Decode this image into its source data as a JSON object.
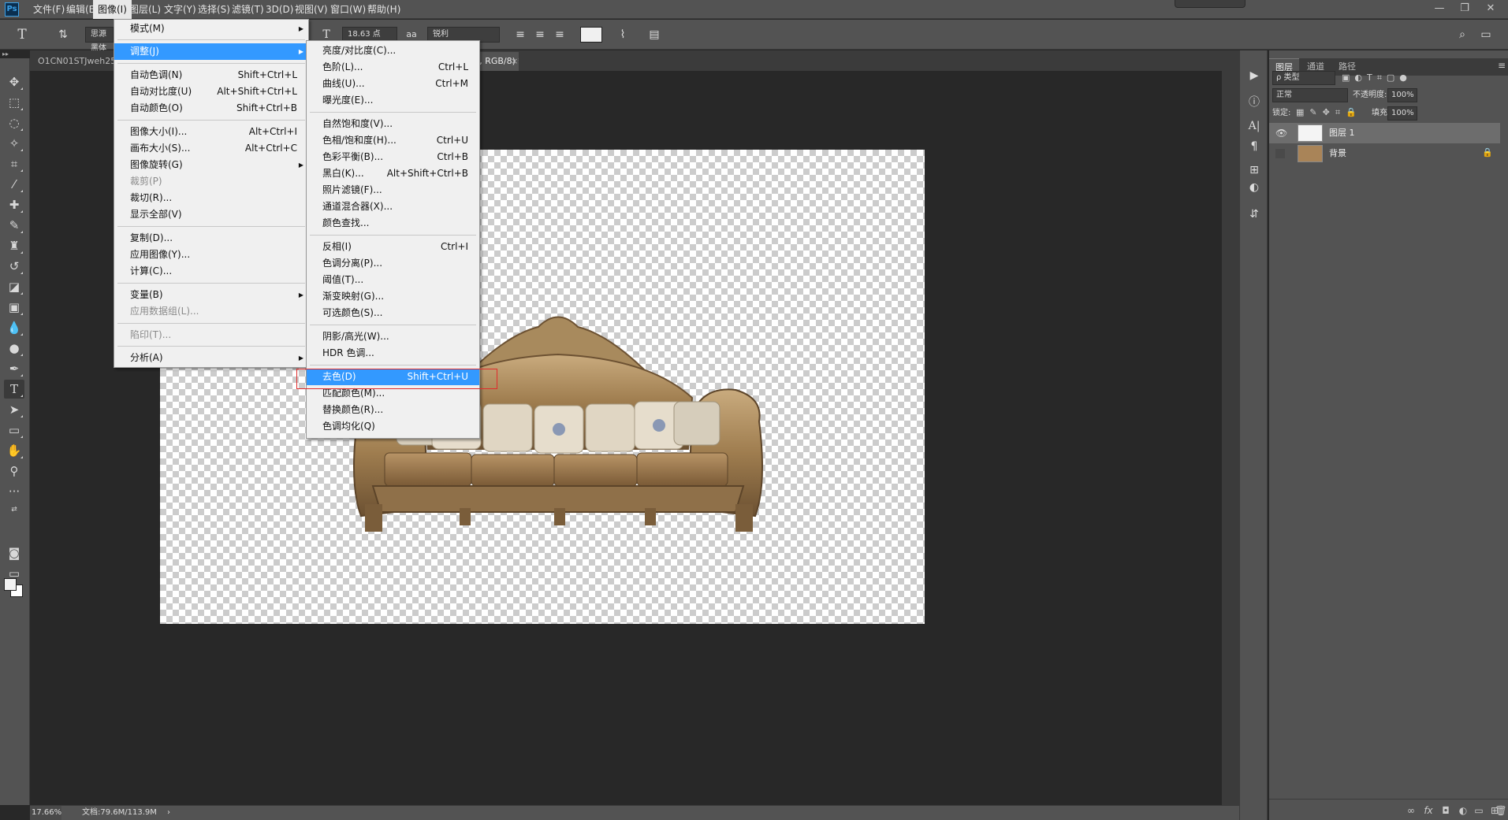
{
  "app": {
    "logo": "Ps"
  },
  "menubar": {
    "items": [
      "文件(F)",
      "编辑(E)",
      "图像(I)",
      "图层(L)",
      "文字(Y)",
      "选择(S)",
      "滤镜(T)",
      "3D(D)",
      "视图(V)",
      "窗口(W)",
      "帮助(H)"
    ],
    "active": "图像(I)"
  },
  "window_controls": {
    "minimize": "—",
    "restore": "❐",
    "close": "✕"
  },
  "options": {
    "font_family": "思源黑体",
    "font_size": "18.63 点",
    "antialias_icon": "aa",
    "antialias": "锐利"
  },
  "tabs": [
    {
      "label": "O1CN01STJweh25F",
      "active": false
    },
    {
      "label": "d @ 17.7% (图层 1, RGB/8) *",
      "active": true,
      "close": "×"
    }
  ],
  "status": {
    "zoom": "17.66%",
    "doc_size": "文档:79.6M/113.9M",
    "arrow": "›"
  },
  "image_menu": {
    "groups": [
      [
        {
          "label": "模式(M)",
          "submenu": true
        }
      ],
      [
        {
          "label": "调整(J)",
          "submenu": true,
          "highlighted": true
        }
      ],
      [
        {
          "label": "自动色调(N)",
          "shortcut": "Shift+Ctrl+L"
        },
        {
          "label": "自动对比度(U)",
          "shortcut": "Alt+Shift+Ctrl+L"
        },
        {
          "label": "自动颜色(O)",
          "shortcut": "Shift+Ctrl+B"
        }
      ],
      [
        {
          "label": "图像大小(I)...",
          "shortcut": "Alt+Ctrl+I"
        },
        {
          "label": "画布大小(S)...",
          "shortcut": "Alt+Ctrl+C"
        },
        {
          "label": "图像旋转(G)",
          "submenu": true
        },
        {
          "label": "裁剪(P)",
          "disabled": true
        },
        {
          "label": "裁切(R)..."
        },
        {
          "label": "显示全部(V)"
        }
      ],
      [
        {
          "label": "复制(D)..."
        },
        {
          "label": "应用图像(Y)..."
        },
        {
          "label": "计算(C)..."
        }
      ],
      [
        {
          "label": "变量(B)",
          "submenu": true
        },
        {
          "label": "应用数据组(L)...",
          "disabled": true
        }
      ],
      [
        {
          "label": "陷印(T)...",
          "disabled": true
        }
      ],
      [
        {
          "label": "分析(A)",
          "submenu": true
        }
      ]
    ]
  },
  "adjust_menu": {
    "groups": [
      [
        {
          "label": "亮度/对比度(C)..."
        },
        {
          "label": "色阶(L)...",
          "shortcut": "Ctrl+L"
        },
        {
          "label": "曲线(U)...",
          "shortcut": "Ctrl+M"
        },
        {
          "label": "曝光度(E)..."
        }
      ],
      [
        {
          "label": "自然饱和度(V)..."
        },
        {
          "label": "色相/饱和度(H)...",
          "shortcut": "Ctrl+U"
        },
        {
          "label": "色彩平衡(B)...",
          "shortcut": "Ctrl+B"
        },
        {
          "label": "黑白(K)...",
          "shortcut": "Alt+Shift+Ctrl+B"
        },
        {
          "label": "照片滤镜(F)..."
        },
        {
          "label": "通道混合器(X)..."
        },
        {
          "label": "颜色查找..."
        }
      ],
      [
        {
          "label": "反相(I)",
          "shortcut": "Ctrl+I"
        },
        {
          "label": "色调分离(P)..."
        },
        {
          "label": "阈值(T)..."
        },
        {
          "label": "渐变映射(G)..."
        },
        {
          "label": "可选颜色(S)..."
        }
      ],
      [
        {
          "label": "阴影/高光(W)..."
        },
        {
          "label": "HDR 色调..."
        }
      ],
      [
        {
          "label": "去色(D)",
          "shortcut": "Shift+Ctrl+U",
          "highlighted": true
        },
        {
          "label": "匹配颜色(M)..."
        },
        {
          "label": "替换颜色(R)..."
        },
        {
          "label": "色调均化(Q)"
        }
      ]
    ]
  },
  "layers_panel": {
    "tabs": [
      "图层",
      "通道",
      "路径"
    ],
    "filter_kind": "ρ 类型",
    "blend_mode": "正常",
    "opacity_label": "不透明度:",
    "opacity": "100%",
    "lock_label": "锁定:",
    "fill_label": "填充:",
    "fill": "100%",
    "layers": [
      {
        "name": "图层 1",
        "visible": true,
        "selected": true
      },
      {
        "name": "背景",
        "visible": false,
        "locked": true
      }
    ]
  }
}
